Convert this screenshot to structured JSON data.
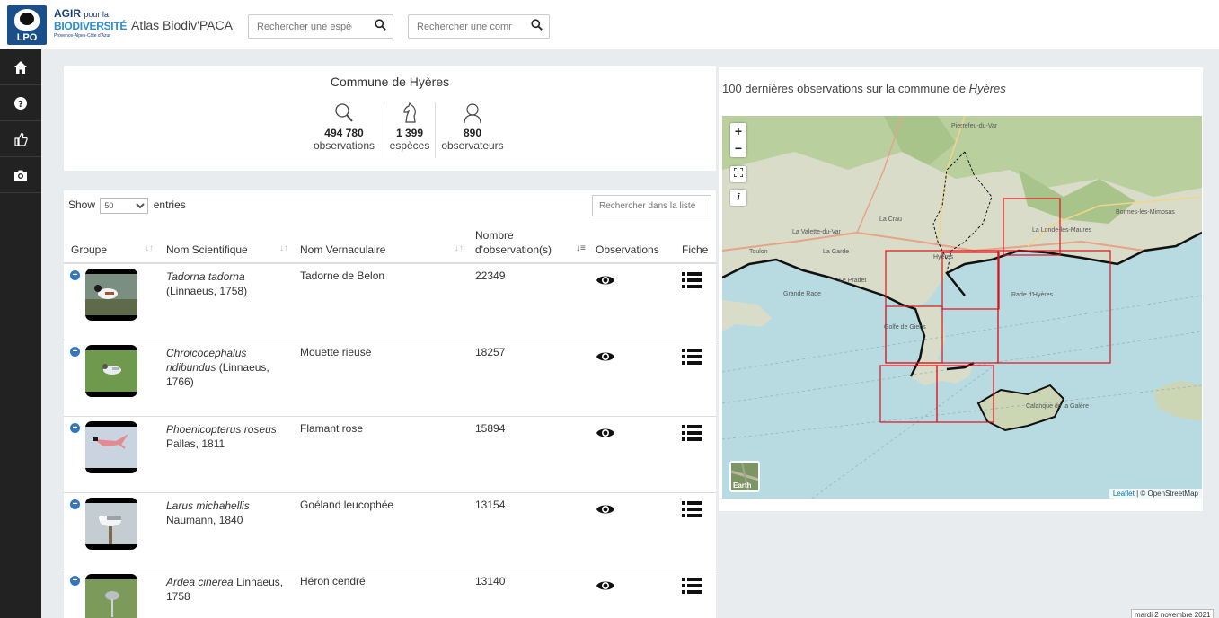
{
  "header": {
    "logo_lpo": "LPO",
    "logo_agir_line1": "AGIR",
    "logo_agir_pour": "pour la",
    "logo_agir_line2": "BIODIVERSITÉ",
    "logo_agir_region": "Provence-Alpes-Côte d'Azur",
    "atlas_title": "Atlas Biodiv'PACA",
    "search_species_placeholder": "Rechercher une espèce",
    "search_commune_placeholder": "Rechercher une commun"
  },
  "sidebar": {
    "items": [
      {
        "icon": "home-icon"
      },
      {
        "icon": "question-circle-icon"
      },
      {
        "icon": "thumbs-up-icon"
      },
      {
        "icon": "camera-icon"
      }
    ]
  },
  "commune": {
    "title": "Commune de Hyères",
    "stats": {
      "observations_value": "494 780",
      "observations_label": "observations",
      "especes_value": "1 399",
      "especes_label": "espèces",
      "observateurs_value": "890",
      "observateurs_label": "observateurs"
    }
  },
  "table": {
    "show_label": "Show",
    "entries_label": "entries",
    "page_size": "50",
    "search_placeholder": "Rechercher dans la liste",
    "headers": {
      "groupe": "Groupe",
      "nom_scientifique": "Nom Scientifique",
      "nom_vernaculaire": "Nom Vernaculaire",
      "nombre_line1": "Nombre",
      "nombre_line2": "d'observation(s)",
      "observations": "Observations",
      "fiche": "Fiche"
    },
    "rows": [
      {
        "sci_name": "Tadorna tadorna",
        "author": "(Linnaeus, 1758)",
        "vern": "Tadorne de Belon",
        "count": "22349"
      },
      {
        "sci_name": "Chroicocephalus ridibundus",
        "author": "(Linnaeus, 1766)",
        "vern": "Mouette rieuse",
        "count": "18257"
      },
      {
        "sci_name": "Phoenicopterus roseus",
        "author": "Pallas, 1811",
        "vern": "Flamant rose",
        "count": "15894"
      },
      {
        "sci_name": "Larus michahellis",
        "author": "Naumann, 1840",
        "vern": "Goéland leucophée",
        "count": "13154"
      },
      {
        "sci_name": "Ardea cinerea",
        "author": "Linnaeus, 1758",
        "vern": "Héron cendré",
        "count": "13140"
      }
    ]
  },
  "map": {
    "title_prefix": "100 dernières observations sur la commune de",
    "title_commune": "Hyères",
    "zoom_in": "+",
    "zoom_out": "−",
    "info_label": "i",
    "earth_label": "Earth",
    "attribution_leaflet": "Leaflet",
    "attribution_osm": "| © OpenStreetMap",
    "places": [
      "Pierrefeu-du-Var",
      "La Crau",
      "La Valette-du-Var",
      "La Garde",
      "Toulon",
      "Hyères",
      "Le Pradet",
      "Grande Rade",
      "La Londe-les-Maures",
      "Bormes-les-Mimosas",
      "Rade d'Hyères",
      "Golfe de Giens",
      "Calanque de la Galère"
    ]
  },
  "footer": {
    "date": "mardi 2 novembre 2021"
  },
  "colors": {
    "sidebar": "#222222",
    "accent_blue": "#2f76c4",
    "sea": "#b7dbe1",
    "grid_red": "#e0101a"
  }
}
